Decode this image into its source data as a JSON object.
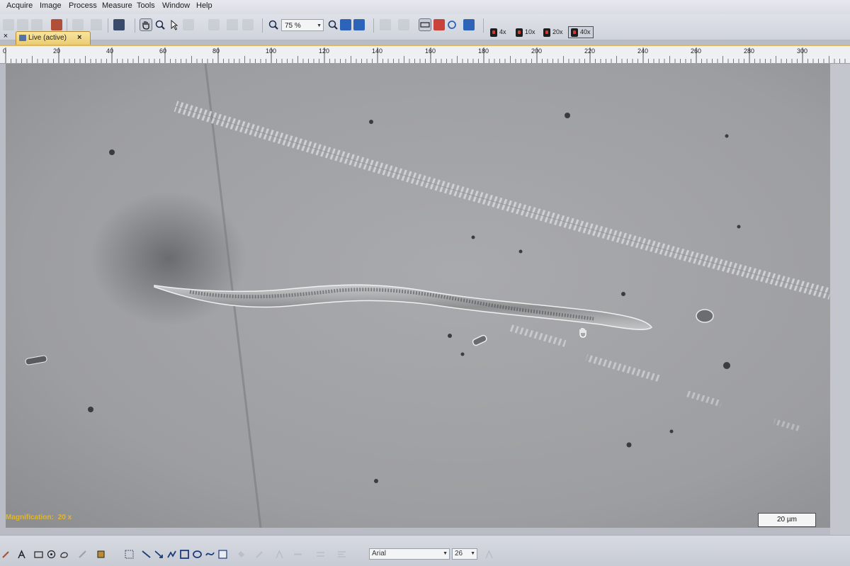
{
  "menu": [
    "Acquire",
    "Image",
    "Process",
    "Measure",
    "Tools",
    "Window",
    "Help"
  ],
  "toolbar": {
    "zoom_value": "75 %",
    "objectives": [
      "4x",
      "10x",
      "20x",
      "40x"
    ],
    "active_objective": "40x"
  },
  "tabs": {
    "close_all": "×",
    "active_tab_label": "Live (active)",
    "tab_close": "×"
  },
  "ruler": {
    "ticks": [
      "0",
      "20",
      "40",
      "60",
      "80",
      "100",
      "120",
      "140",
      "160",
      "180",
      "200",
      "220",
      "240",
      "260",
      "280",
      "300"
    ]
  },
  "overlay": {
    "magnification_label": "Magnification:",
    "magnification_value": "20 x",
    "scale_bar_label": "20 µm",
    "label_color": "#e2b72a"
  },
  "annotation_toolbar": {
    "font_name": "Arial",
    "font_size": "26"
  },
  "icons": {
    "toolbar": [
      "new-icon",
      "open-icon",
      "save-icon",
      "undo-icon",
      "redo-icon",
      "snapshot-icon",
      "pan-icon",
      "zoom-tool-icon",
      "pointer-icon",
      "select-icon",
      "crop-icon",
      "check-icon",
      "cancel-icon",
      "zoom-icon",
      "zoom-in-icon",
      "fit-icon",
      "fullscreen-icon",
      "layout-icon",
      "ruler-icon",
      "camera-icon",
      "circle-icon",
      "display-icon"
    ],
    "bottom": [
      "pen-icon",
      "text-icon",
      "rectangle-icon",
      "circle-target-icon",
      "lasso-icon",
      "brush-icon",
      "stamp-icon",
      "select-region-icon",
      "line-icon",
      "arrow-icon",
      "polyline-icon",
      "square-icon",
      "ellipse-icon",
      "freehand-icon",
      "image-icon"
    ]
  }
}
